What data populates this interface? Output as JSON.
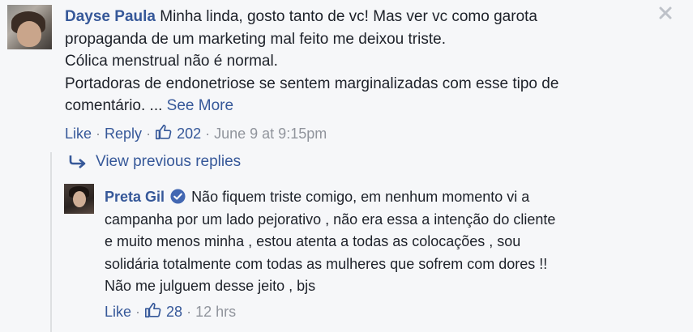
{
  "comment": {
    "author": "Dayse Paula",
    "lines": [
      "Minha linda, gosto tanto de vc! Mas ver vc como garota",
      "propaganda de um marketing mal feito me deixou triste.",
      "Cólica menstrual não é normal.",
      "Portadoras de endonetriose se sentem marginalizadas com esse tipo de",
      "comentário. ..."
    ],
    "see_more": "See More",
    "like_label": "Like",
    "reply_label": "Reply",
    "like_count": "202",
    "timestamp": "June 9 at 9:15pm",
    "separator": " · "
  },
  "replies": {
    "view_previous": "View previous replies"
  },
  "reply": {
    "author": "Preta Gil",
    "lines": [
      "Não fiquem triste comigo, em nenhum momento vi a",
      "campanha por um lado pejorativo , não era essa a intenção do cliente",
      "e muito menos minha , estou atenta a todas as colocações , sou",
      "solidária totalmente com todas as mulheres que sofrem com dores !!",
      "Não me julguem desse jeito , bjs"
    ],
    "like_label": "Like",
    "like_count": "28",
    "timestamp": "12 hrs",
    "separator": " · "
  },
  "colors": {
    "link": "#365899",
    "meta": "#90949c",
    "text": "#1d2129",
    "background": "#f6f7f9"
  }
}
